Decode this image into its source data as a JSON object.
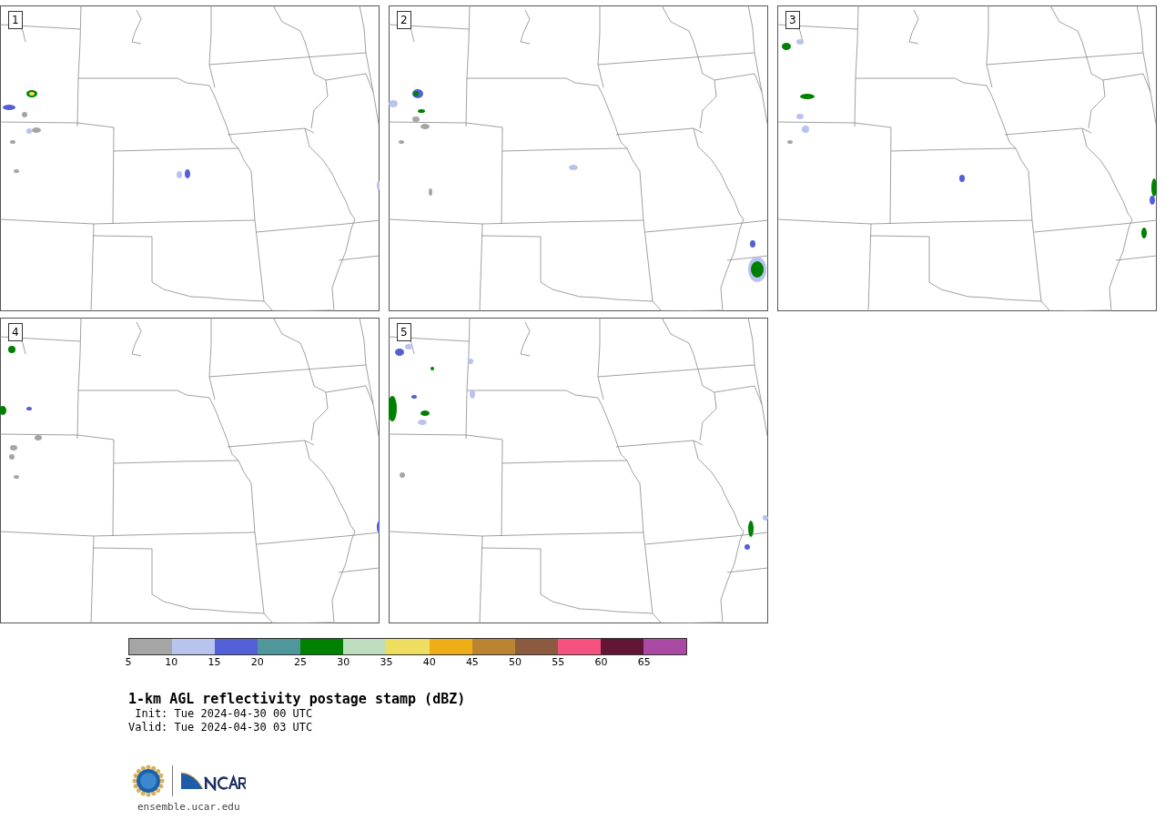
{
  "panels": [
    {
      "label": "1"
    },
    {
      "label": "2"
    },
    {
      "label": "3"
    },
    {
      "label": "4"
    },
    {
      "label": "5"
    }
  ],
  "colorbar": {
    "bins": [
      {
        "label": "5",
        "color": "#a5a5a5"
      },
      {
        "label": "10",
        "color": "#b8c3ee"
      },
      {
        "label": "15",
        "color": "#525fd6"
      },
      {
        "label": "20",
        "color": "#4f979b"
      },
      {
        "label": "25",
        "color": "#008000"
      },
      {
        "label": "30",
        "color": "#bedfbf"
      },
      {
        "label": "35",
        "color": "#efdd5f"
      },
      {
        "label": "40",
        "color": "#efad17"
      },
      {
        "label": "45",
        "color": "#bb8433"
      },
      {
        "label": "50",
        "color": "#8b5a3f"
      },
      {
        "label": "55",
        "color": "#f5527f"
      },
      {
        "label": "60",
        "color": "#631535"
      },
      {
        "label": "65",
        "color": "#ab4aa4"
      }
    ]
  },
  "title": "1-km AGL reflectivity postage stamp (dBZ)",
  "init": " Init: Tue 2024-04-30 00 UTC",
  "valid": "Valid: Tue 2024-04-30 03 UTC",
  "footer": {
    "url": "ensemble.ucar.edu"
  }
}
